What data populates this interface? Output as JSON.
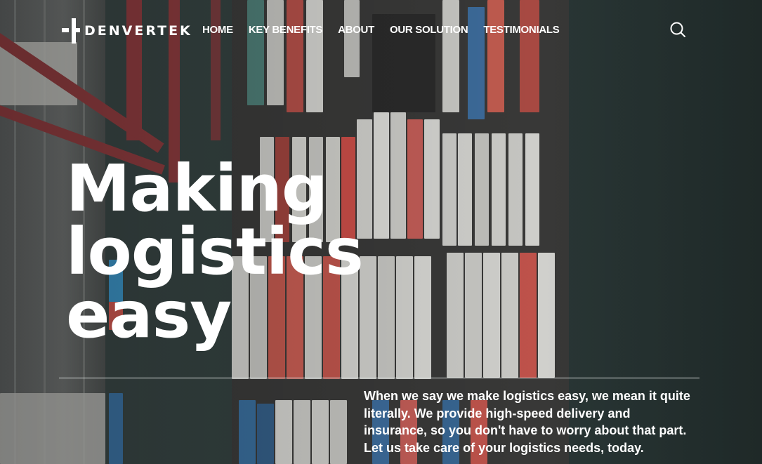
{
  "brand": {
    "name": "DENVERTEK"
  },
  "nav": {
    "items": [
      {
        "label": "HOME"
      },
      {
        "label": "KEY BENEFITS"
      },
      {
        "label": "ABOUT"
      },
      {
        "label": "OUR SOLUTION"
      },
      {
        "label": "TESTIMONIALS"
      }
    ]
  },
  "header": {
    "search_icon": "search-icon"
  },
  "hero": {
    "title_lines": [
      "Making",
      "logistics",
      "easy"
    ],
    "description": "When we say we make logistics easy, we mean it quite literally. We provide high-speed delivery and insurance, so you don't have to worry about that part. Let us take care of your logistics needs, today."
  },
  "colors": {
    "text": "#ffffff",
    "divider": "#d7dcdb",
    "water": "#33413f",
    "crane": "#8c3b3e"
  }
}
